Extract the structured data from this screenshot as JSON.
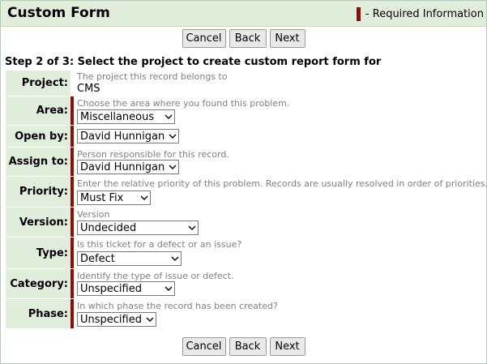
{
  "header": {
    "title": "Custom Form",
    "required_info": "- Required Information"
  },
  "buttons": {
    "cancel": "Cancel",
    "back": "Back",
    "next": "Next"
  },
  "step_title": "Step 2 of 3: Select the project to create custom report form for",
  "fields": {
    "project": {
      "label": "Project:",
      "hint": "The project this record belongs to",
      "value": "CMS"
    },
    "area": {
      "label": "Area:",
      "hint": "Choose the area where you found this problem.",
      "value": "Miscellaneous"
    },
    "open_by": {
      "label": "Open by:",
      "value": "David Hunnigan"
    },
    "assign_to": {
      "label": "Assign to:",
      "hint": "Person responsible for this record.",
      "value": "David Hunnigan"
    },
    "priority": {
      "label": "Priority:",
      "hint": "Enter the relative priority of this problem. Records are usually resolved in order of priorities.",
      "value": "Must Fix"
    },
    "version": {
      "label": "Version:",
      "hint": "Version",
      "value": "Undecided"
    },
    "type": {
      "label": "Type:",
      "hint": "Is this ticket for a defect or an issue?",
      "value": "Defect"
    },
    "category": {
      "label": "Category:",
      "hint": "Identify the type of issue or defect.",
      "value": "Unspecified"
    },
    "phase": {
      "label": "Phase:",
      "hint": "In which phase the record has been created?",
      "value": "Unspecified"
    }
  },
  "colors": {
    "header_bg": "#e2eedc",
    "label_bg": "#e2eedc",
    "required_bar": "#8b0d0d"
  }
}
